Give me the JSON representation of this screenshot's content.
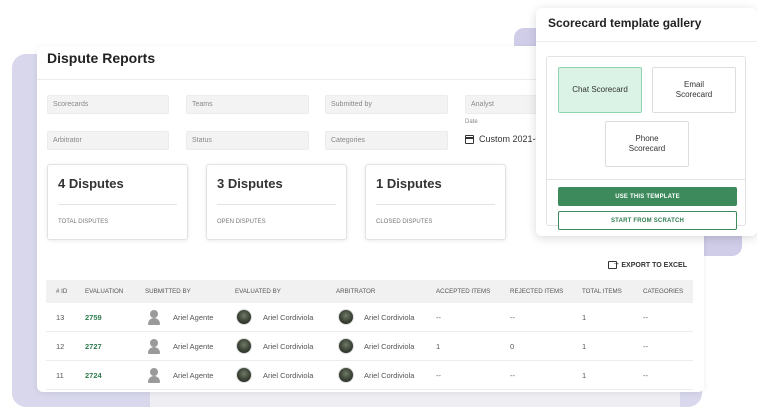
{
  "page": {
    "title": "Dispute Reports"
  },
  "filters": {
    "scorecards": "Scorecards",
    "teams": "Teams",
    "submitted_by": "Submitted by",
    "analyst": "Analyst",
    "arbitrator": "Arbitrator",
    "status": "Status",
    "categories": "Categories",
    "date_label": "Date",
    "date_value": "Custom 2021-0"
  },
  "stats": [
    {
      "value": "4 Disputes",
      "label": "TOTAL DISPUTES"
    },
    {
      "value": "3 Disputes",
      "label": "OPEN DISPUTES"
    },
    {
      "value": "1 Disputes",
      "label": "CLOSED DISPUTES"
    }
  ],
  "export_label": "EXPORT TO EXCEL",
  "table": {
    "columns": [
      "# ID",
      "EVALUATION",
      "SUBMITTED BY",
      "EVALUATED BY",
      "ARBITRATOR",
      "ACCEPTED ITEMS",
      "REJECTED ITEMS",
      "TOTAL ITEMS",
      "CATEGORIES"
    ],
    "rows": [
      {
        "id": "13",
        "evaluation": "2759",
        "submitted_by": "Ariel Agente",
        "evaluated_by": "Ariel Cordiviola",
        "arbitrator": "Ariel Cordiviola",
        "accepted": "--",
        "rejected": "--",
        "total": "1",
        "categories": "--"
      },
      {
        "id": "12",
        "evaluation": "2727",
        "submitted_by": "Ariel Agente",
        "evaluated_by": "Ariel Cordiviola",
        "arbitrator": "Ariel Cordiviola",
        "accepted": "1",
        "rejected": "0",
        "total": "1",
        "categories": "--"
      },
      {
        "id": "11",
        "evaluation": "2724",
        "submitted_by": "Ariel Agente",
        "evaluated_by": "Ariel Cordiviola",
        "arbitrator": "Ariel Cordiviola",
        "accepted": "--",
        "rejected": "--",
        "total": "1",
        "categories": "--"
      }
    ]
  },
  "gallery": {
    "title": "Scorecard template gallery",
    "templates": {
      "chat": "Chat Scorecard",
      "email": "Email Scorecard",
      "phone": "Phone Scorecard"
    },
    "use_button": "USE THIS TEMPLATE",
    "scratch_button": "START FROM SCRATCH"
  },
  "colors": {
    "accent_green": "#3d8a5c",
    "selected_template_bg": "#daf3e6",
    "backdrop_lavender": "#d8d7ec"
  }
}
